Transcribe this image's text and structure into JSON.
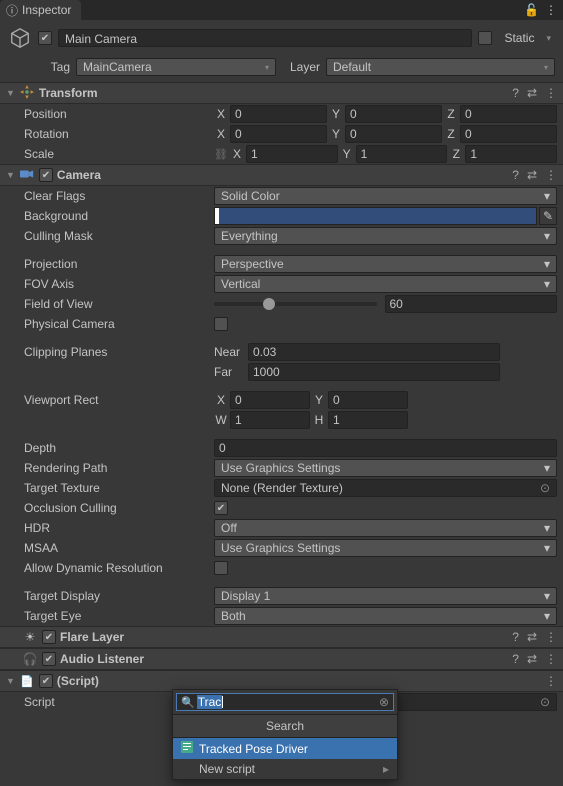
{
  "tab": "Inspector",
  "gameObject": {
    "enabled": true,
    "name": "Main Camera",
    "staticLabel": "Static",
    "tagLabel": "Tag",
    "tag": "MainCamera",
    "layerLabel": "Layer",
    "layer": "Default"
  },
  "transform": {
    "title": "Transform",
    "positionLabel": "Position",
    "rotationLabel": "Rotation",
    "scaleLabel": "Scale",
    "position": {
      "x": "0",
      "y": "0",
      "z": "0"
    },
    "rotation": {
      "x": "0",
      "y": "0",
      "z": "0"
    },
    "scale": {
      "x": "1",
      "y": "1",
      "z": "1"
    }
  },
  "camera": {
    "title": "Camera",
    "clearFlagsLabel": "Clear Flags",
    "clearFlags": "Solid Color",
    "backgroundLabel": "Background",
    "backgroundColor": "#324d7a",
    "cullingMaskLabel": "Culling Mask",
    "cullingMask": "Everything",
    "projectionLabel": "Projection",
    "projection": "Perspective",
    "fovAxisLabel": "FOV Axis",
    "fovAxis": "Vertical",
    "fovLabel": "Field of View",
    "fov": "60",
    "physicalCameraLabel": "Physical Camera",
    "clippingLabel": "Clipping Planes",
    "nearLabel": "Near",
    "near": "0.03",
    "farLabel": "Far",
    "far": "1000",
    "viewportLabel": "Viewport Rect",
    "viewport": {
      "x": "0",
      "y": "0",
      "w": "1",
      "h": "1"
    },
    "depthLabel": "Depth",
    "depth": "0",
    "renderingPathLabel": "Rendering Path",
    "renderingPath": "Use Graphics Settings",
    "targetTextureLabel": "Target Texture",
    "targetTexture": "None (Render Texture)",
    "occlusionLabel": "Occlusion Culling",
    "hdrLabel": "HDR",
    "hdr": "Off",
    "msaaLabel": "MSAA",
    "msaa": "Use Graphics Settings",
    "allowDynamicLabel": "Allow Dynamic Resolution",
    "targetDisplayLabel": "Target Display",
    "targetDisplay": "Display 1",
    "targetEyeLabel": "Target Eye",
    "targetEye": "Both"
  },
  "flareLayer": {
    "title": "Flare Layer"
  },
  "audioListener": {
    "title": "Audio Listener"
  },
  "script": {
    "title": "(Script)",
    "scriptLabel": "Script",
    "scriptValue": ""
  },
  "search": {
    "query": "Trac",
    "title": "Search",
    "item1": "Tracked Pose Driver",
    "item2": "New script"
  },
  "axes": {
    "X": "X",
    "Y": "Y",
    "Z": "Z",
    "W": "W",
    "H": "H"
  }
}
